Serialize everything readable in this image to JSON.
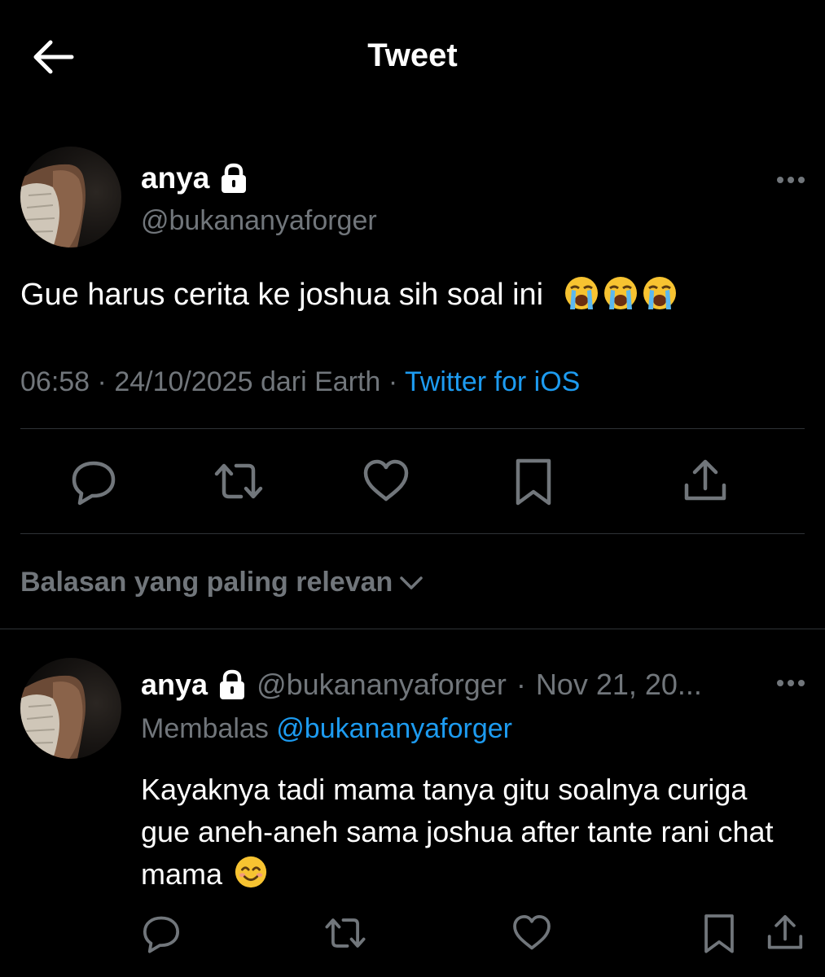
{
  "header": {
    "title": "Tweet",
    "back_icon": "arrow-left-icon"
  },
  "tweet": {
    "name": "anya",
    "handle": "@bukananyaforger",
    "text": "Gue harus cerita ke joshua sih soal ini",
    "emojis": [
      "loudly-crying-face",
      "loudly-crying-face",
      "loudly-crying-face"
    ],
    "time": "06:58",
    "separator": "·",
    "date_location": "24/10/2025 dari Earth",
    "source": "Twitter for iOS",
    "actions": [
      "reply-icon",
      "retweet-icon",
      "like-icon",
      "bookmark-icon",
      "share-icon"
    ]
  },
  "sort": {
    "label": "Balasan yang paling relevan"
  },
  "reply": {
    "name": "anya",
    "handle": "@bukananyaforger",
    "separator": "·",
    "date": "Nov 21, 20...",
    "replying_prefix": "Membalas",
    "replying_to": "@bukananyaforger",
    "text": "Kayaknya tadi mama tanya gitu soalnya curiga gue aneh-aneh sama joshua after tante rani chat mama",
    "emoji": "smiling-face"
  },
  "colors": {
    "background": "#000000",
    "text": "#e7e9ea",
    "secondary": "#71767b",
    "link": "#1d9bf0",
    "divider": "#2f3336"
  }
}
